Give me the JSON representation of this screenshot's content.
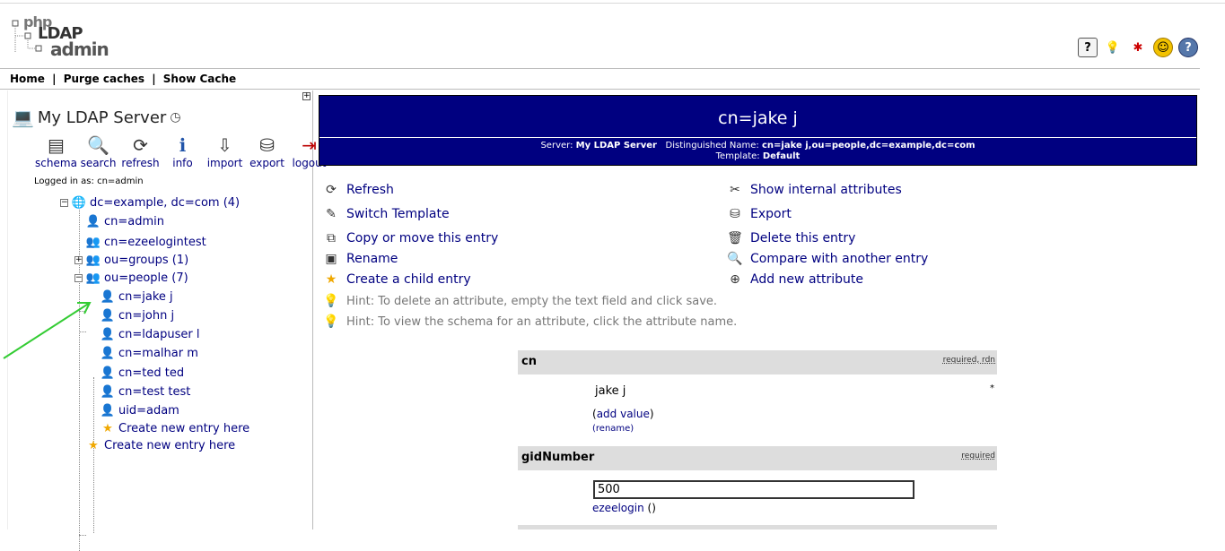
{
  "logo": {
    "php": "php",
    "ldap": "LDAP",
    "admin": "admin"
  },
  "top_icons": [
    "help-icon",
    "bulb-icon",
    "bug-icon",
    "smiley-icon",
    "question-icon"
  ],
  "menu": {
    "home": "Home",
    "purge": "Purge caches",
    "show_cache": "Show Cache",
    "separator": "|"
  },
  "server": {
    "name": "My LDAP Server",
    "logged_in": "Logged in as: cn=admin"
  },
  "tools": [
    {
      "label": "schema",
      "icon": "schema-icon",
      "glyph": "▤"
    },
    {
      "label": "search",
      "icon": "search-icon",
      "glyph": "🔍"
    },
    {
      "label": "refresh",
      "icon": "refresh-icon",
      "glyph": "⟳"
    },
    {
      "label": "info",
      "icon": "info-icon",
      "glyph": "ℹ"
    },
    {
      "label": "import",
      "icon": "import-icon",
      "glyph": "⇩"
    },
    {
      "label": "export",
      "icon": "export-icon",
      "glyph": "⛁"
    },
    {
      "label": "logout",
      "icon": "logout-icon",
      "glyph": "⇥"
    }
  ],
  "tree": {
    "root": "dc=example, dc=com (4)",
    "admin": "cn=admin",
    "ezeelogintest": "cn=ezeelogintest",
    "groups": "ou=groups (1)",
    "people": "ou=people (7)",
    "people_children": [
      "cn=jake j",
      "cn=john j",
      "cn=ldapuser l",
      "cn=malhar m",
      "cn=ted ted",
      "cn=test test",
      "uid=adam"
    ],
    "create_child": "Create new entry here",
    "create_root": "Create new entry here",
    "plus": "+",
    "minus": "−"
  },
  "entry": {
    "title": "cn=jake j",
    "server_label": "Server:",
    "server_value": "My LDAP Server",
    "dn_label": "Distinguished Name:",
    "dn_value": "cn=jake j,ou=people,dc=example,dc=com",
    "template_label": "Template:",
    "template_value": "Default"
  },
  "actions_left": [
    "Refresh",
    "Switch Template",
    "Copy or move this entry",
    "Rename",
    "Create a child entry"
  ],
  "actions_right": [
    "Show internal attributes",
    "Export",
    "Delete this entry",
    "Compare with another entry",
    "Add new attribute"
  ],
  "hints": [
    "Hint: To delete an attribute, empty the text field and click save.",
    "Hint: To view the schema for an attribute, click the attribute name."
  ],
  "attributes": {
    "cn": {
      "name": "cn",
      "flags": "required, rdn",
      "value": "jake j",
      "add_value": "add value",
      "rename": "(rename)",
      "star": "*"
    },
    "gid": {
      "name": "gidNumber",
      "flags": "required",
      "value": "500",
      "group_link": "ezeelogin",
      "group_paren": "()"
    }
  },
  "colors": {
    "header_bg": "#000080",
    "link": "#000080",
    "attr_head_bg": "#dddddd",
    "hint": "#777777",
    "annotation_arrow": "#33cc33"
  }
}
